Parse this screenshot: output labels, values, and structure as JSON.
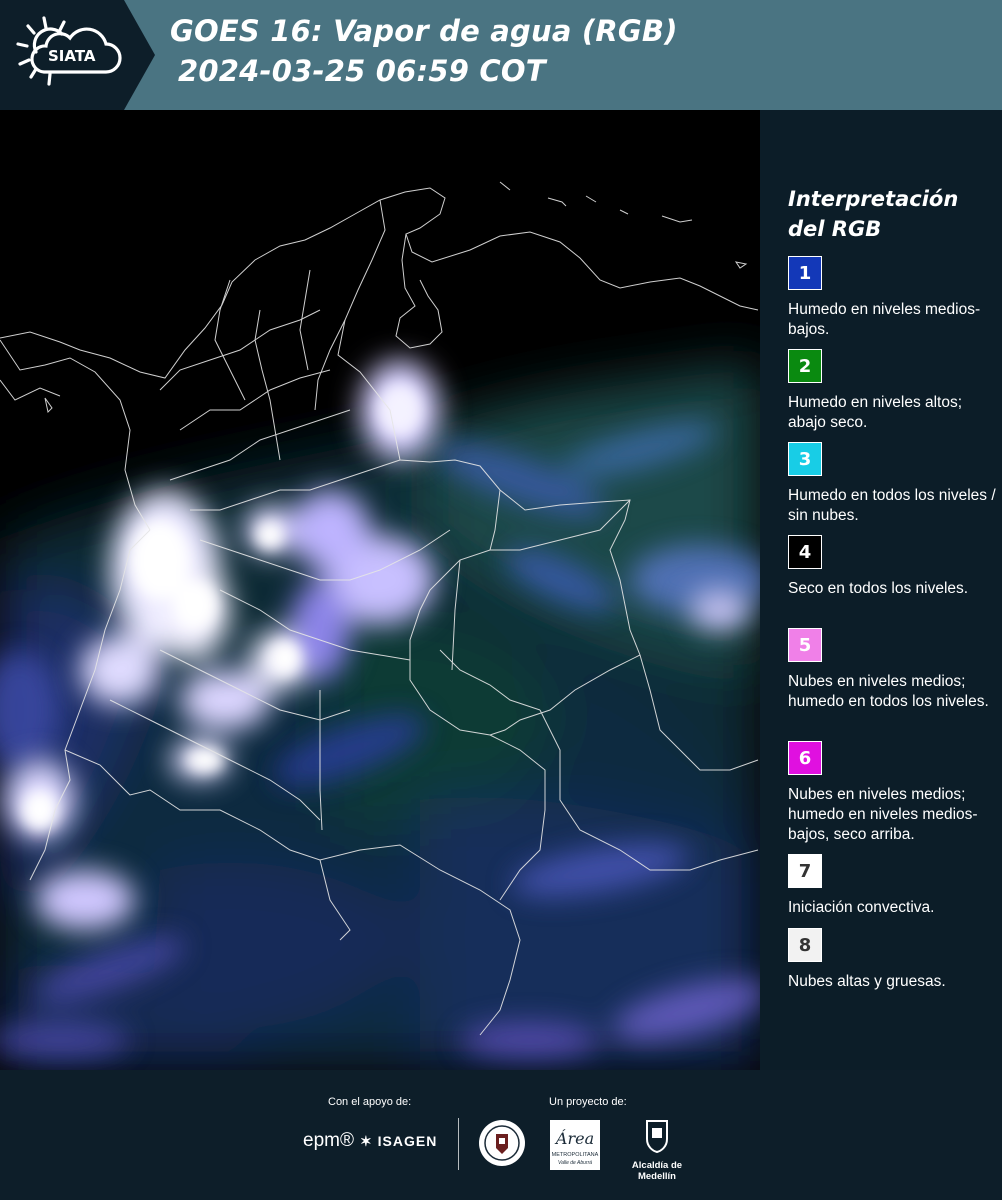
{
  "header": {
    "logo_text": "SIATA",
    "title_line1": "GOES 16: Vapor de agua (RGB)",
    "title_line2": "2024-03-25 06:59 COT"
  },
  "legend": {
    "title": "Interpretación del RGB",
    "items": [
      {
        "number": "1",
        "color": "#1338b8",
        "text_color": "#ffffff",
        "description": "Humedo en niveles medios-bajos."
      },
      {
        "number": "2",
        "color": "#0a8a10",
        "text_color": "#ffffff",
        "description": "Humedo en niveles altos; abajo seco."
      },
      {
        "number": "3",
        "color": "#18cde6",
        "text_color": "#ffffff",
        "description": "Humedo en todos los niveles / sin nubes."
      },
      {
        "number": "4",
        "color": "#000000",
        "text_color": "#ffffff",
        "description": "Seco en todos los niveles."
      },
      {
        "number": "5",
        "color": "#f080e8",
        "text_color": "#ffffff",
        "description": "Nubes en niveles medios; humedo en todos los niveles."
      },
      {
        "number": "6",
        "color": "#e010e0",
        "text_color": "#ffffff",
        "description": "Nubes en niveles medios; humedo en niveles medios-bajos, seco arriba."
      },
      {
        "number": "7",
        "color": "#ffffff",
        "text_color": "#333333",
        "description": "Iniciación convectiva."
      },
      {
        "number": "8",
        "color": "#f2f2f2",
        "text_color": "#333333",
        "description": "Nubes altas y gruesas."
      }
    ]
  },
  "footer": {
    "support_label": "Con el apoyo de:",
    "project_label": "Un proyecto de:",
    "epm_logo": "epm®",
    "isagen_logo": "ISAGEN",
    "area_logo_lines": [
      "Área",
      "METROPOLITANA",
      "Valle de Aburrá"
    ],
    "alcaldia_label": "Alcaldía de Medellín"
  },
  "colors": {
    "header_bg": "#4a7482",
    "logo_block_bg": "#0d1e29",
    "legend_bg": "#0c1d28",
    "footer_bg": "#0d1e29"
  }
}
